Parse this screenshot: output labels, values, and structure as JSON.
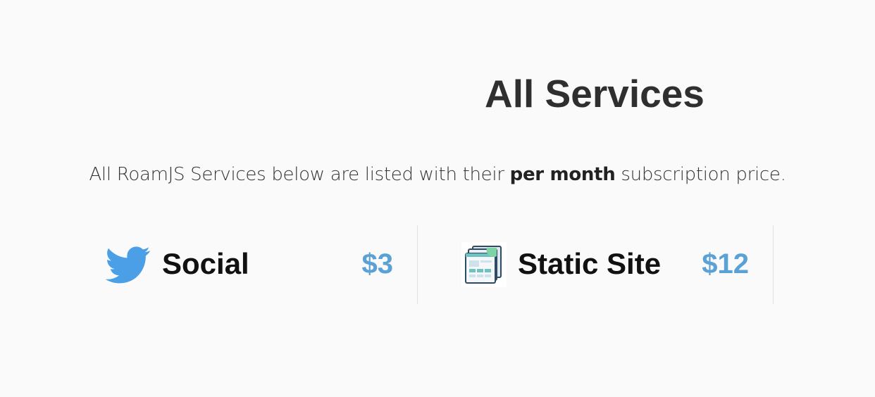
{
  "header": {
    "title": "All Services"
  },
  "intro": {
    "prefix": "All RoamJS Services below are listed with their ",
    "emphasis": "per month",
    "suffix": " subscription price."
  },
  "services": [
    {
      "name": "Social",
      "price": "$3",
      "icon": "twitter-bird-icon"
    },
    {
      "name": "Static Site",
      "price": "$12",
      "icon": "static-site-icon"
    }
  ],
  "colors": {
    "background": "#fafafa",
    "price": "#5aa1d6",
    "twitter": "#4a9fe6",
    "divider": "#e2e2e2"
  }
}
